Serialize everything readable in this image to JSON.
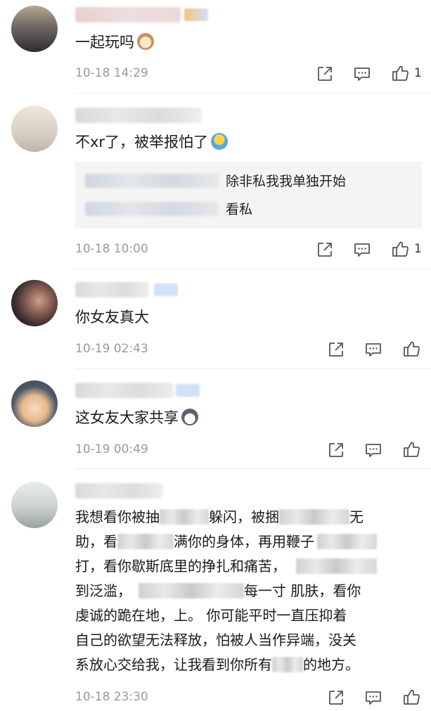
{
  "comments": [
    {
      "text": "一起玩吗",
      "emoji": "cat-emoji",
      "time": "10-18 14:29",
      "likes": "1"
    },
    {
      "text": "不xr了，被举报怕了",
      "emoji": "shrug-emoji",
      "time": "10-18 10:00",
      "likes": "1",
      "replies": [
        {
          "text": "除非私我我单独开始"
        },
        {
          "text": "看私"
        }
      ]
    },
    {
      "text": "你女友真大",
      "time": "10-19 02:43",
      "likes": ""
    },
    {
      "text": "这女友大家共享",
      "emoji": "husky-emoji",
      "time": "10-19 00:49",
      "likes": ""
    },
    {
      "lines": [
        {
          "a": "我想看你被抽",
          "b": "躲闪，被捆",
          "c": "无"
        },
        {
          "a": "助，看",
          "b": "满你的身体，再用鞭子"
        },
        {
          "a": "打，看你歇斯底里的挣扎和痛苦，"
        },
        {
          "a": "到泛滥，",
          "b": "每一寸 肌肤，看你"
        },
        {
          "a": "虔诚的跪在地，上。 你可能平时一直压抑着"
        },
        {
          "a": "自己的欲望无法释放，怕被人当作异端，没关"
        },
        {
          "a": "系放心交给我，让我看到你所有",
          "b": "的地方。"
        }
      ],
      "time": "10-18 23:30",
      "likes": ""
    }
  ],
  "icons": {
    "forward": "share-forward-icon",
    "comment": "comment-icon",
    "like": "thumbs-up-icon"
  },
  "colors": {
    "meta_text": "#9a9a9a",
    "reply_bg": "#f4f4f4",
    "divider": "#ececec"
  }
}
